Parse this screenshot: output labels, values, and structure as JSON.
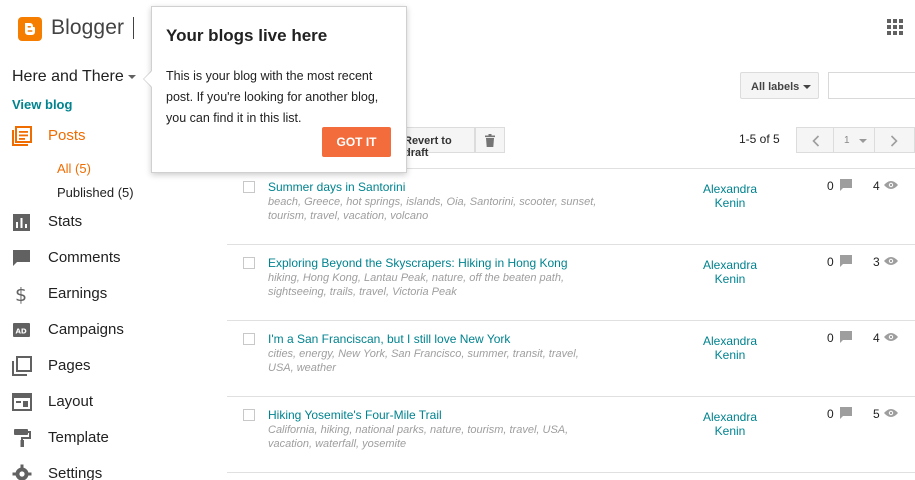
{
  "app": {
    "brand": "Blogger"
  },
  "sidebar": {
    "blog_title": "Here and There",
    "view_blog": "View blog",
    "nav": [
      {
        "label": "Posts",
        "icon": "posts-icon"
      },
      {
        "label": "Stats",
        "icon": "stats-icon"
      },
      {
        "label": "Comments",
        "icon": "comments-icon"
      },
      {
        "label": "Earnings",
        "icon": "earnings-icon"
      },
      {
        "label": "Campaigns",
        "icon": "campaigns-icon"
      },
      {
        "label": "Pages",
        "icon": "pages-icon"
      },
      {
        "label": "Layout",
        "icon": "layout-icon"
      },
      {
        "label": "Template",
        "icon": "template-icon"
      },
      {
        "label": "Settings",
        "icon": "settings-icon"
      }
    ],
    "sub": [
      {
        "label": "All (5)"
      },
      {
        "label": "Published (5)"
      }
    ]
  },
  "toolbar": {
    "labels_dropdown": "All labels",
    "revert_label": "Revert to draft",
    "count": "1-5 of 5",
    "page": "1"
  },
  "posts": [
    {
      "title": "Summer days in Santorini",
      "labels": "beach, Greece, hot springs, islands, Oia, Santorini, scooter, sunset, tourism, travel, vacation, volcano",
      "author": "Alexandra Kenin",
      "comments": "0",
      "views": "4"
    },
    {
      "title": "Exploring Beyond the Skyscrapers: Hiking in Hong Kong",
      "labels": "hiking, Hong Kong, Lantau Peak, nature, off the beaten path, sightseeing, trails, travel, Victoria Peak",
      "author": "Alexandra Kenin",
      "comments": "0",
      "views": "3"
    },
    {
      "title": "I'm a San Franciscan, but I still love New York",
      "labels": "cities, energy, New York, San Francisco, summer, transit, travel, USA, weather",
      "author": "Alexandra Kenin",
      "comments": "0",
      "views": "4"
    },
    {
      "title": "Hiking Yosemite's Four-Mile Trail",
      "labels": "California, hiking, national parks, nature, tourism, travel, USA, vacation, waterfall, yosemite",
      "author": "Alexandra Kenin",
      "comments": "0",
      "views": "5"
    }
  ],
  "popup": {
    "title": "Your blogs live here",
    "body": "This is your blog with the most recent post. If you're looking for another blog, you can find it in this list.",
    "button": "GOT IT"
  },
  "colors": {
    "accent": "#ef6c00",
    "link": "#00838f",
    "button": "#f36c3c"
  }
}
